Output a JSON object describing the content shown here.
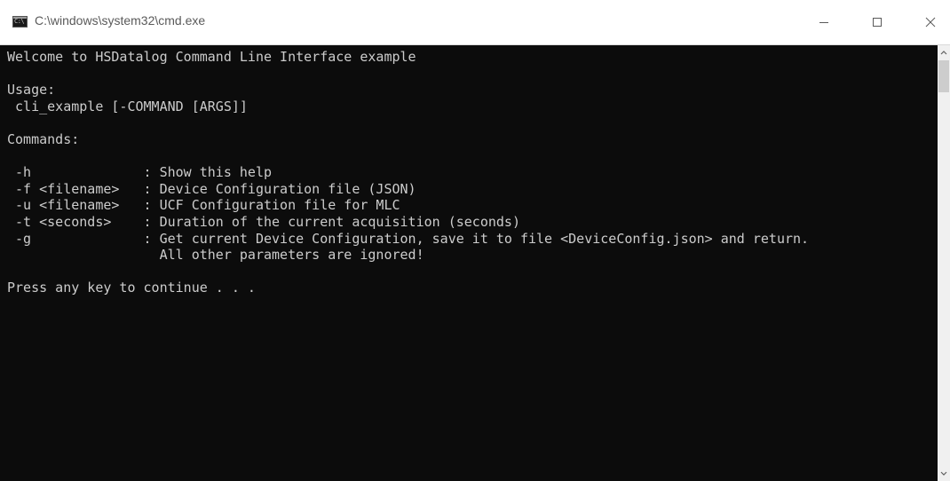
{
  "window": {
    "title": "C:\\windows\\system32\\cmd.exe",
    "icon_text": "C:\\"
  },
  "console": {
    "lines": [
      "Welcome to HSDatalog Command Line Interface example",
      "",
      "Usage:",
      " cli_example [-COMMAND [ARGS]]",
      "",
      "Commands:",
      "",
      " -h              : Show this help",
      " -f <filename>   : Device Configuration file (JSON)",
      " -u <filename>   : UCF Configuration file for MLC",
      " -t <seconds>    : Duration of the current acquisition (seconds)",
      " -g              : Get current Device Configuration, save it to file <DeviceConfig.json> and return.",
      "                   All other parameters are ignored!",
      "",
      "Press any key to continue . . ."
    ]
  },
  "colors": {
    "console_background": "#0c0c0c",
    "console_text": "#cccccc",
    "titlebar_background": "#ffffff",
    "scrollbar_track": "#f0f0f0",
    "scrollbar_thumb": "#cdcdcd"
  },
  "icons": {
    "app": "cmd-app-icon",
    "minimize": "minimize-icon",
    "maximize": "maximize-icon",
    "close": "close-icon",
    "scroll_up": "chevron-up-icon",
    "scroll_down": "chevron-down-icon"
  }
}
